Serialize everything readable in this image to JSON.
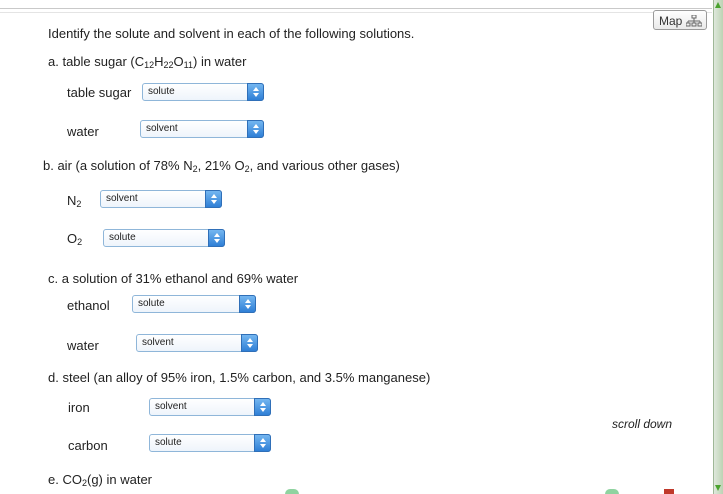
{
  "map_button": {
    "label": "Map",
    "icon": "sitemap-icon"
  },
  "instructions": "Identify the solute and solvent in each of the following solutions.",
  "scroll_hint": "scroll down",
  "parts": {
    "a": {
      "prefix": "a. table sugar (C",
      "s1": "12",
      "m1": "H",
      "s2": "22",
      "m2": "O",
      "s3": "11",
      "suffix": ") in water",
      "rows": [
        {
          "label": "table sugar",
          "value": "solute"
        },
        {
          "label": "water",
          "value": "solvent"
        }
      ]
    },
    "b": {
      "p1": "b. air (a solution of 78% N",
      "s1": "2",
      "p2": ", 21% O",
      "s2": "2",
      "p3": ", and various other gases)",
      "rows": [
        {
          "label": "N",
          "sub": "2",
          "value": "solvent"
        },
        {
          "label": "O",
          "sub": "2",
          "value": "solute"
        }
      ]
    },
    "c": {
      "title": "c. a solution of 31% ethanol and 69% water",
      "rows": [
        {
          "label": "ethanol",
          "value": "solute"
        },
        {
          "label": "water",
          "value": "solvent"
        }
      ]
    },
    "d": {
      "title": "d. steel (an alloy of 95% iron, 1.5% carbon, and 3.5% manganese)",
      "rows": [
        {
          "label": "iron",
          "value": "solvent"
        },
        {
          "label": "carbon",
          "value": "solute"
        }
      ]
    },
    "e": {
      "prefix": "e. CO",
      "sub": "2",
      "suffix": "(g) in water"
    }
  },
  "colors": {
    "select_accent": "#2f7fd6",
    "scrollbar_accent": "#4aa32e"
  }
}
